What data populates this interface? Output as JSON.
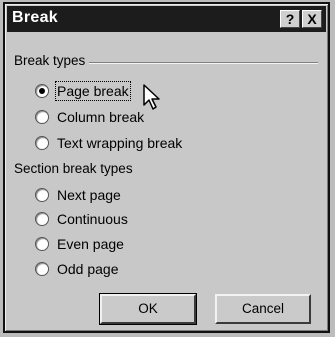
{
  "window": {
    "title": "Break"
  },
  "titlebar_buttons": {
    "help": "?",
    "close": "X"
  },
  "break_types": {
    "heading": "Break types",
    "options": [
      {
        "label": "Page break",
        "accel": "P",
        "selected": true
      },
      {
        "label": "Column break",
        "accel": "C",
        "selected": false
      },
      {
        "label": "Text wrapping break",
        "accel": "w",
        "selected": false
      }
    ]
  },
  "section_break_types": {
    "heading": "Section break types",
    "options": [
      {
        "label": "Next page",
        "accel": "N",
        "selected": false
      },
      {
        "label": "Continuous",
        "accel": "t",
        "selected": false
      },
      {
        "label": "Even page",
        "accel": "E",
        "selected": false
      },
      {
        "label": "Odd page",
        "accel": "O",
        "selected": false
      }
    ]
  },
  "buttons": {
    "ok": "OK",
    "cancel": "Cancel"
  }
}
